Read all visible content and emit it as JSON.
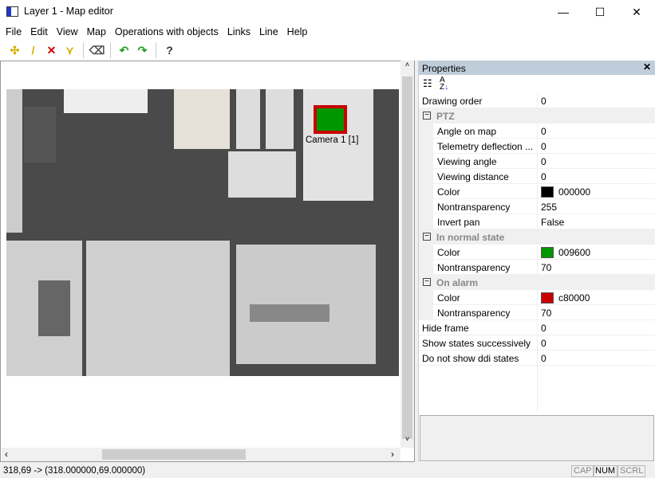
{
  "window": {
    "title": "Layer 1 - Map editor"
  },
  "menu": [
    "File",
    "Edit",
    "View",
    "Map",
    "Operations with objects",
    "Links",
    "Line",
    "Help"
  ],
  "toolbar": [
    {
      "icon": "add-point-icon",
      "glyph": "✣",
      "color": "#d4b000"
    },
    {
      "icon": "draw-line-icon",
      "glyph": "/",
      "color": "#d4b000"
    },
    {
      "icon": "delete-icon",
      "glyph": "✕",
      "color": "#d00000"
    },
    {
      "icon": "connect-points-icon",
      "glyph": "⋎",
      "color": "#d4b000"
    },
    {
      "icon": "eraser-icon",
      "glyph": "⌫",
      "color": "#555"
    },
    {
      "icon": "undo-icon",
      "glyph": "↶",
      "color": "#22a022"
    },
    {
      "icon": "redo-icon",
      "glyph": "↷",
      "color": "#22a022"
    },
    {
      "icon": "help-icon",
      "glyph": "?",
      "color": "#333"
    }
  ],
  "map": {
    "camera_label": "Camera 1 [1]"
  },
  "properties": {
    "title": "Properties",
    "rows": [
      {
        "key": "Drawing order",
        "value": "0"
      },
      {
        "key": "PTZ",
        "category": true
      },
      {
        "key": "Angle on map",
        "value": "0",
        "indent": true
      },
      {
        "key": "Telemetry deflection ...",
        "value": "0",
        "indent": true
      },
      {
        "key": "Viewing angle",
        "value": "0",
        "indent": true
      },
      {
        "key": "Viewing distance",
        "value": "0",
        "indent": true
      },
      {
        "key": "Color",
        "value": "000000",
        "swatch": "#000000",
        "indent": true
      },
      {
        "key": "Nontransparency",
        "value": "255",
        "indent": true
      },
      {
        "key": "Invert pan",
        "value": "False",
        "indent": true
      },
      {
        "key": "In normal state",
        "category": true
      },
      {
        "key": "Color",
        "value": "009600",
        "swatch": "#009600",
        "indent": true
      },
      {
        "key": "Nontransparency",
        "value": "70",
        "indent": true
      },
      {
        "key": "On alarm",
        "category": true
      },
      {
        "key": "Color",
        "value": "c80000",
        "swatch": "#c80000",
        "indent": true
      },
      {
        "key": "Nontransparency",
        "value": "70",
        "indent": true
      },
      {
        "key": "Hide frame",
        "value": "0"
      },
      {
        "key": "Show states successively",
        "value": "0"
      },
      {
        "key": "Do not show ddi states",
        "value": "0"
      }
    ]
  },
  "status": {
    "coords": "318,69 -> (318.000000,69.000000)",
    "cap": "CAP",
    "num": "NUM",
    "scrl": "SCRL"
  }
}
